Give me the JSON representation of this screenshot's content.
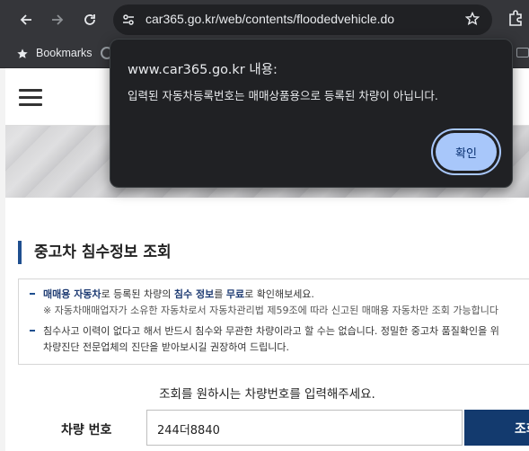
{
  "browser": {
    "url": "car365.go.kr/web/contents/floodedvehicle.do",
    "bookmarks_label": "Bookmarks"
  },
  "dialog": {
    "title": "www.car365.go.kr 내용:",
    "message": "입력된 자동차등록번호는 매매상품용으로 등록된 차량이 아닙니다.",
    "ok_label": "확인"
  },
  "page": {
    "section_title": "중고차 침수정보 조회",
    "info": {
      "line1_a": "매매용 자동차",
      "line1_b": "로 등록된 차량의 ",
      "line1_c": "침수 정보",
      "line1_d": "를 ",
      "line1_e": "무료",
      "line1_f": "로 확인해보세요.",
      "line2": "※ 자동차매매업자가 소유한 자동차로서 자동차관리법 제59조에 따라 신고된 매매용 자동차만 조회 가능합니다",
      "line3": "침수사고 이력이 없다고 해서 반드시 침수와 무관한 차량이라고 할 수는 없습니다. 정밀한 중고차 품질확인을 위",
      "line4": "차량진단 전문업체의 진단을 받아보시길 권장하여 드립니다."
    },
    "prompt": "조회를 원하시는 차량번호를 입력해주세요.",
    "plate_label": "차량 번호",
    "plate_value": "244더8840",
    "search_label": "조회"
  }
}
